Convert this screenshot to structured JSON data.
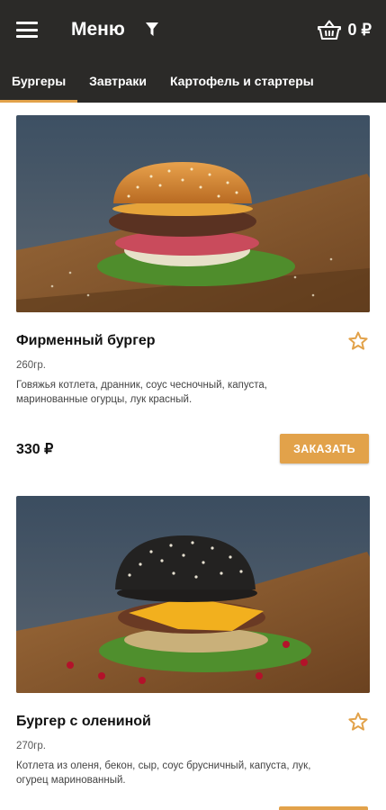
{
  "header": {
    "title": "Меню",
    "cart_total": "0 ₽"
  },
  "tabs": [
    {
      "label": "Бургеры",
      "active": true
    },
    {
      "label": "Завтраки",
      "active": false
    },
    {
      "label": "Картофель и стартеры",
      "active": false
    }
  ],
  "products": [
    {
      "name": "Фирменный бургер",
      "weight": "260гр.",
      "description": "Говяжья котлета, дранник, соус чесночный, капуста, маринованные огурцы, лук красный.",
      "price": "330 ₽",
      "order_label": "ЗАКАЗАТЬ"
    },
    {
      "name": "Бургер с олениной",
      "weight": "270гр.",
      "description": "Котлета из оленя, бекон, сыр, соус брусничный, капуста, лук, огурец маринованный."
    }
  ],
  "colors": {
    "header_bg": "#2b2a28",
    "accent": "#e2a24a"
  },
  "icons": [
    "menu-icon",
    "filter-icon",
    "basket-icon",
    "star-outline-icon"
  ]
}
